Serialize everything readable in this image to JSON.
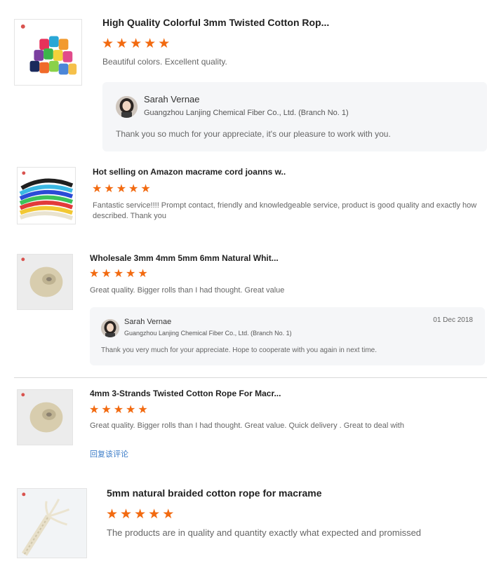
{
  "colors": {
    "star": "#f26a10",
    "link": "#3b7cc8",
    "reply_bg": "#f5f6f8"
  },
  "reviews": [
    {
      "product_title": "High Quality Colorful 3mm Twisted Cotton Rop...",
      "rating": 5,
      "comment": "Beautiful colors. Excellent quality.",
      "reply": {
        "name": "Sarah Vernae",
        "company": "Guangzhou Lanjing Chemical Fiber Co., Ltd. (Branch No. 1)",
        "text": "Thank you so much for your appreciate, it's our pleasure to work with you."
      }
    },
    {
      "product_title": "Hot selling on Amazon macrame cord joanns w..",
      "rating": 5,
      "comment": "Fantastic service!!!! Prompt contact, friendly and knowledgeable service, product is good quality and exactly how described. Thank you"
    },
    {
      "product_title": "Wholesale 3mm 4mm 5mm 6mm Natural Whit...",
      "rating": 5,
      "comment": "Great quality. Bigger rolls than I had thought. Great value",
      "reply": {
        "name": "Sarah Vernae",
        "company": "Guangzhou Lanjing Chemical Fiber Co., Ltd. (Branch No. 1)",
        "text": "Thank you very much for your appreciate. Hope to cooperate with you again in next time.",
        "date": "01 Dec 2018"
      }
    },
    {
      "product_title": "4mm 3-Strands Twisted Cotton Rope For Macr...",
      "rating": 5,
      "comment": "Great quality. Bigger rolls than I had thought. Great value. Quick delivery . Great to deal with",
      "reply_link": "回复该评论"
    },
    {
      "product_title": "5mm natural braided cotton rope for macrame",
      "rating": 5,
      "comment": "The products are in quality and quantity exactly what expected and promissed"
    }
  ]
}
